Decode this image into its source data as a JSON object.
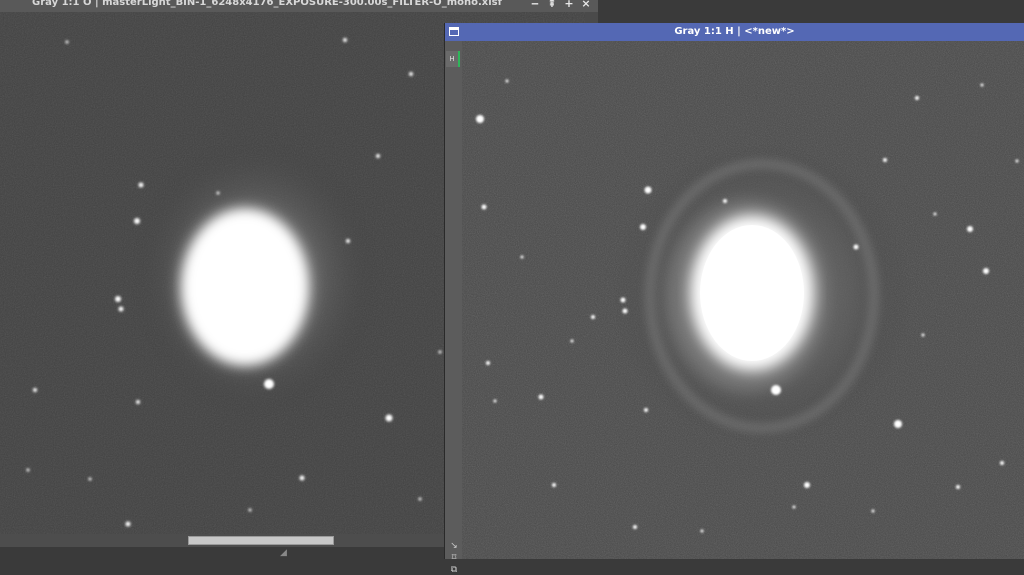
{
  "left_window": {
    "title": "Gray 1:1 O | masterLight_BIN-1_6248x4176_EXPOSURE-300.00s_FILTER-O_mono.xisf",
    "controls": [
      "‒",
      "⇞",
      "+",
      "×"
    ],
    "content_description": "Planetary nebula, OIII channel"
  },
  "right_window": {
    "title": "Gray 1:1 H | <*new*>",
    "mask_tab": "H",
    "side_buttons": [
      "↘",
      "⌑",
      "⧉"
    ],
    "content_description": "Planetary nebula, H-alpha channel"
  },
  "colors": {
    "active_title": "#5468b4",
    "inactive_title": "#595959",
    "mask_marker": "#2fb65a"
  }
}
